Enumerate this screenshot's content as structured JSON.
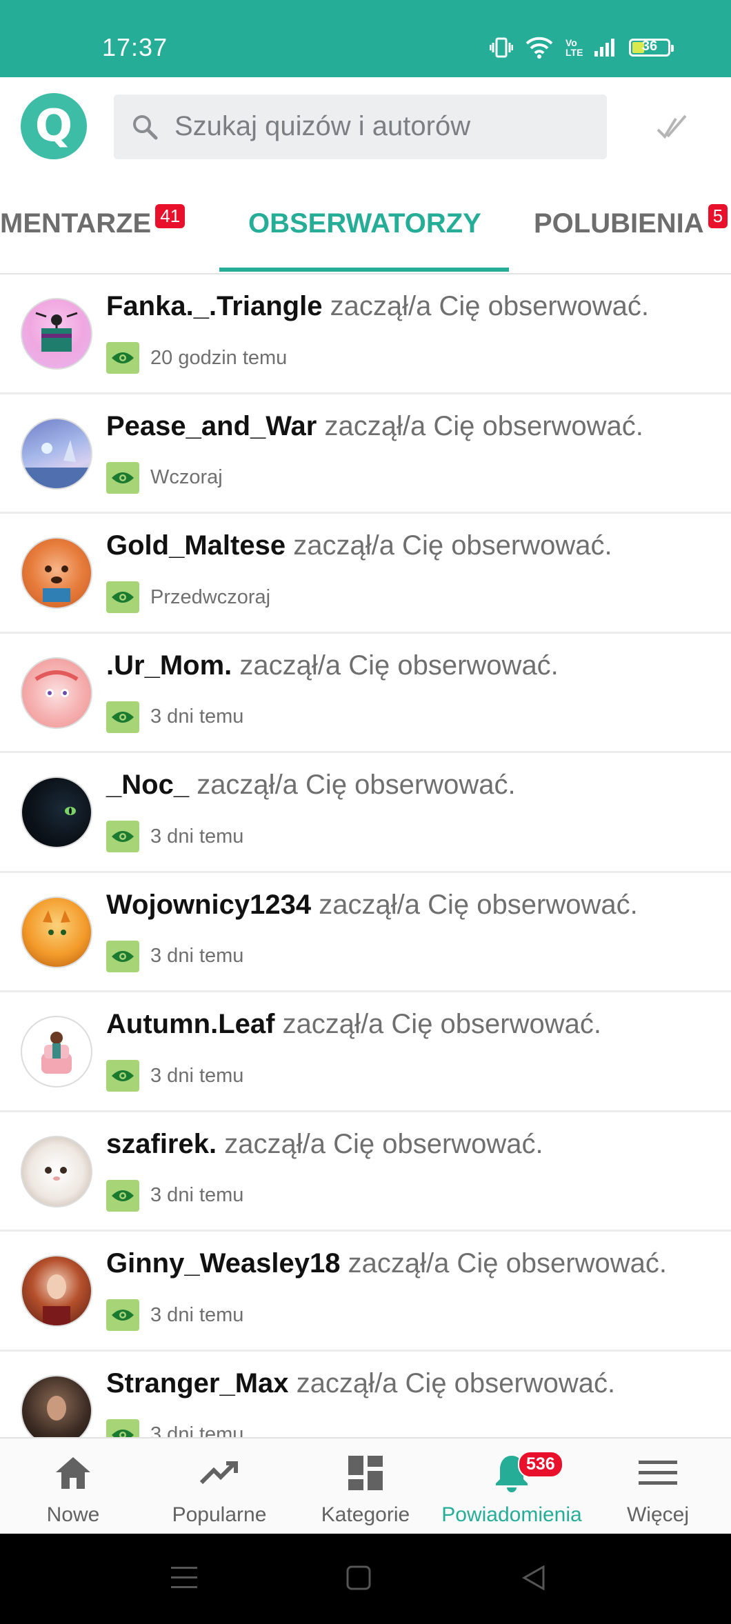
{
  "status_bar": {
    "time": "17:37",
    "battery": "36",
    "network_label": "Vo LTE"
  },
  "header": {
    "logo_letter": "Q",
    "search_placeholder": "Szukaj quizów i autorów"
  },
  "tabs": [
    {
      "label": "MENTARZE",
      "badge": "41"
    },
    {
      "label": "OBSERWATORZY",
      "active": true
    },
    {
      "label": "POLUBIENIA",
      "badge": "5"
    }
  ],
  "notifications": [
    {
      "user": "Fanka._.Triangle",
      "action": "zaczął/a Cię obserwować.",
      "time": "20 godzin temu"
    },
    {
      "user": "Pease_and_War",
      "action": "zaczął/a Cię obserwować.",
      "time": "Wczoraj"
    },
    {
      "user": "Gold_Maltese",
      "action": "zaczął/a Cię obserwować.",
      "time": "Przedwczoraj"
    },
    {
      "user": ".Ur_Mom.",
      "action": "zaczął/a Cię obserwować.",
      "time": "3 dni temu"
    },
    {
      "user": "_Noc_",
      "action": "zaczął/a Cię obserwować.",
      "time": "3 dni temu"
    },
    {
      "user": "Wojownicy1234",
      "action": "zaczął/a Cię obserwować.",
      "time": "3 dni temu"
    },
    {
      "user": "Autumn.Leaf",
      "action": "zaczął/a Cię obserwować.",
      "time": "3 dni temu"
    },
    {
      "user": "szafirek.",
      "action": "zaczął/a Cię obserwować.",
      "time": "3 dni temu"
    },
    {
      "user": "Ginny_Weasley18",
      "action": "zaczął/a Cię obserwować.",
      "time": "3 dni temu"
    },
    {
      "user": "Stranger_Max",
      "action": "zaczął/a Cię obserwować.",
      "time": "3 dni temu"
    }
  ],
  "bottom_nav": [
    {
      "label": "Nowe",
      "icon": "home-icon"
    },
    {
      "label": "Popularne",
      "icon": "trending-icon"
    },
    {
      "label": "Kategorie",
      "icon": "categories-icon"
    },
    {
      "label": "Powiadomienia",
      "icon": "bell-icon",
      "badge": "536",
      "active": true
    },
    {
      "label": "Więcej",
      "icon": "menu-icon"
    }
  ],
  "colors": {
    "accent": "#26ad98",
    "badge": "#e8102b",
    "eye_box": "#a6d476"
  }
}
